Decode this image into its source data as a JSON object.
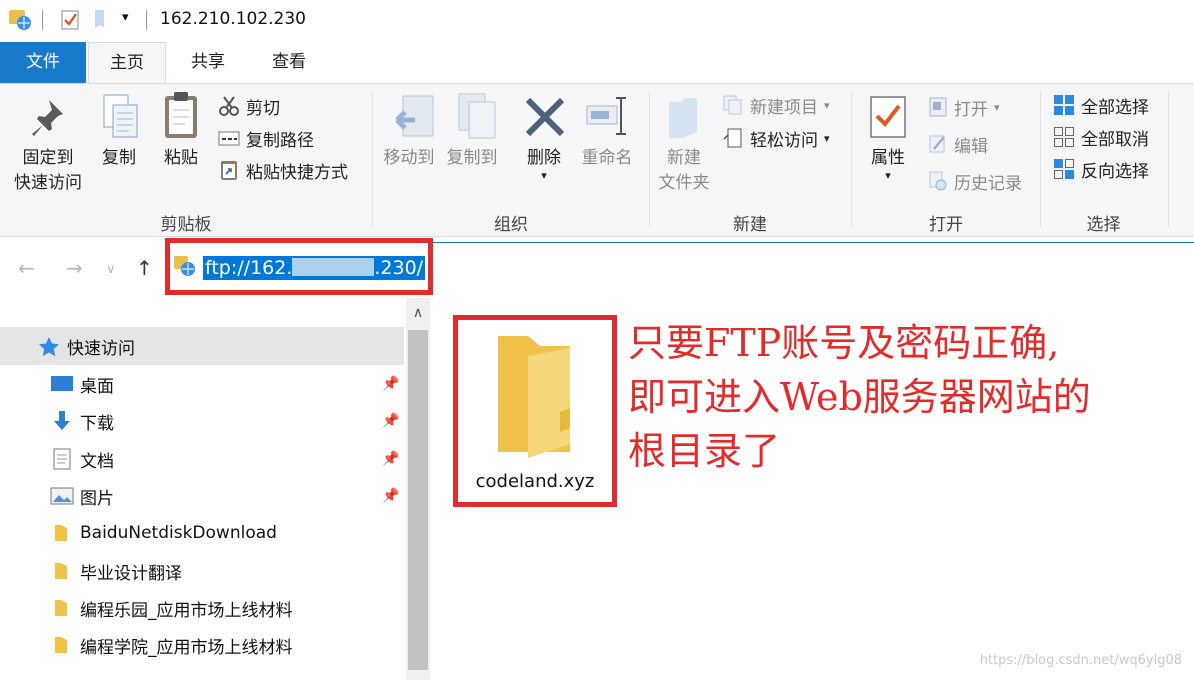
{
  "window": {
    "title": "162.210.102.230"
  },
  "tabs": [
    {
      "label": "文件"
    },
    {
      "label": "主页"
    },
    {
      "label": "共享"
    },
    {
      "label": "查看"
    }
  ],
  "ribbon": {
    "clipboard": {
      "group_label": "剪贴板",
      "pin_line1": "固定到",
      "pin_line2": "快速访问",
      "copy": "复制",
      "paste": "粘贴",
      "cut": "剪切",
      "copy_path": "复制路径",
      "paste_shortcut": "粘贴快捷方式"
    },
    "organize": {
      "group_label": "组织",
      "move_to": "移动到",
      "copy_to": "复制到",
      "delete": "删除",
      "rename": "重命名"
    },
    "new": {
      "group_label": "新建",
      "new_folder_line1": "新建",
      "new_folder_line2": "文件夹",
      "new_item": "新建项目",
      "easy_access": "轻松访问"
    },
    "open": {
      "group_label": "打开",
      "properties": "属性",
      "open": "打开",
      "edit": "编辑",
      "history": "历史记录"
    },
    "select": {
      "group_label": "选择",
      "select_all": "全部选择",
      "select_none": "全部取消",
      "invert": "反向选择"
    }
  },
  "address": {
    "prefix": "ftp://162.",
    "suffix": ".230/"
  },
  "nav": {
    "quick_access": "快速访问",
    "items": [
      {
        "label": "桌面",
        "pinned": true
      },
      {
        "label": "下载",
        "pinned": true
      },
      {
        "label": "文档",
        "pinned": true
      },
      {
        "label": "图片",
        "pinned": true
      },
      {
        "label": "BaiduNetdiskDownload"
      },
      {
        "label": "毕业设计翻译"
      },
      {
        "label": "编程乐园_应用市场上线材料"
      },
      {
        "label": "编程学院_应用市场上线材料"
      }
    ]
  },
  "content": {
    "folder_name": "codeland.xyz",
    "annotation_lines": [
      "只要FTP账号及密码正确,",
      "即可进入Web服务器网站的",
      "根目录了"
    ]
  },
  "watermark": "https://blog.csdn.net/wq6ylg08",
  "colors": {
    "accent": "#1979ca",
    "highlight_red": "#e22b2b",
    "selection": "#0078d7"
  }
}
